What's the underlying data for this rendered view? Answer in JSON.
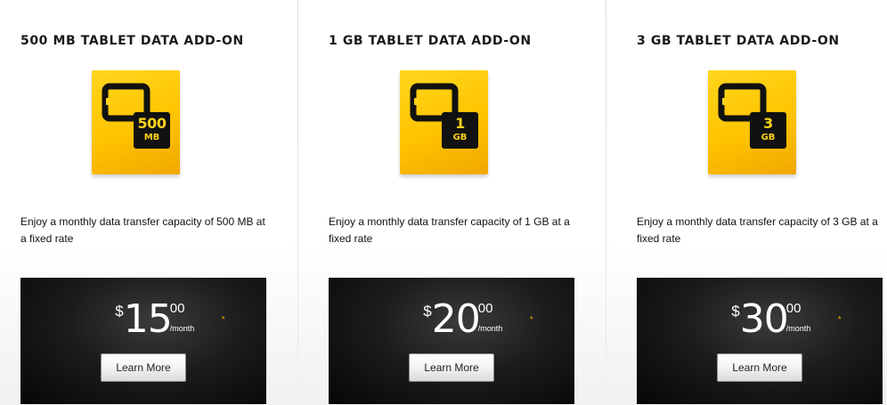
{
  "colors": {
    "tile_yellow": "#ffc300",
    "badge_black": "#111111",
    "price_bg": "#0d0d0d",
    "asterisk": "#f5a100"
  },
  "cards": [
    {
      "title": "500 MB TABLET DATA ADD-ON",
      "icon": "tablet-data-500mb-icon",
      "badge_amount": "500",
      "badge_unit": "MB",
      "description": "Enjoy a monthly data transfer capacity of 500 MB at a fixed rate",
      "price": {
        "currency": "$",
        "dollars": "15",
        "cents": "00",
        "period": "/month",
        "asterisk": "*"
      },
      "button_label": "Learn More"
    },
    {
      "title": "1 GB TABLET DATA ADD-ON",
      "icon": "tablet-data-1gb-icon",
      "badge_amount": "1",
      "badge_unit": "GB",
      "description": "Enjoy a monthly data transfer capacity of 1 GB at a fixed rate",
      "price": {
        "currency": "$",
        "dollars": "20",
        "cents": "00",
        "period": "/month",
        "asterisk": "*"
      },
      "button_label": "Learn More"
    },
    {
      "title": "3 GB TABLET DATA ADD-ON",
      "icon": "tablet-data-3gb-icon",
      "badge_amount": "3",
      "badge_unit": "GB",
      "description": "Enjoy a monthly data transfer capacity of 3 GB at a fixed rate",
      "price": {
        "currency": "$",
        "dollars": "30",
        "cents": "00",
        "period": "/month",
        "asterisk": "*"
      },
      "button_label": "Learn More"
    }
  ]
}
